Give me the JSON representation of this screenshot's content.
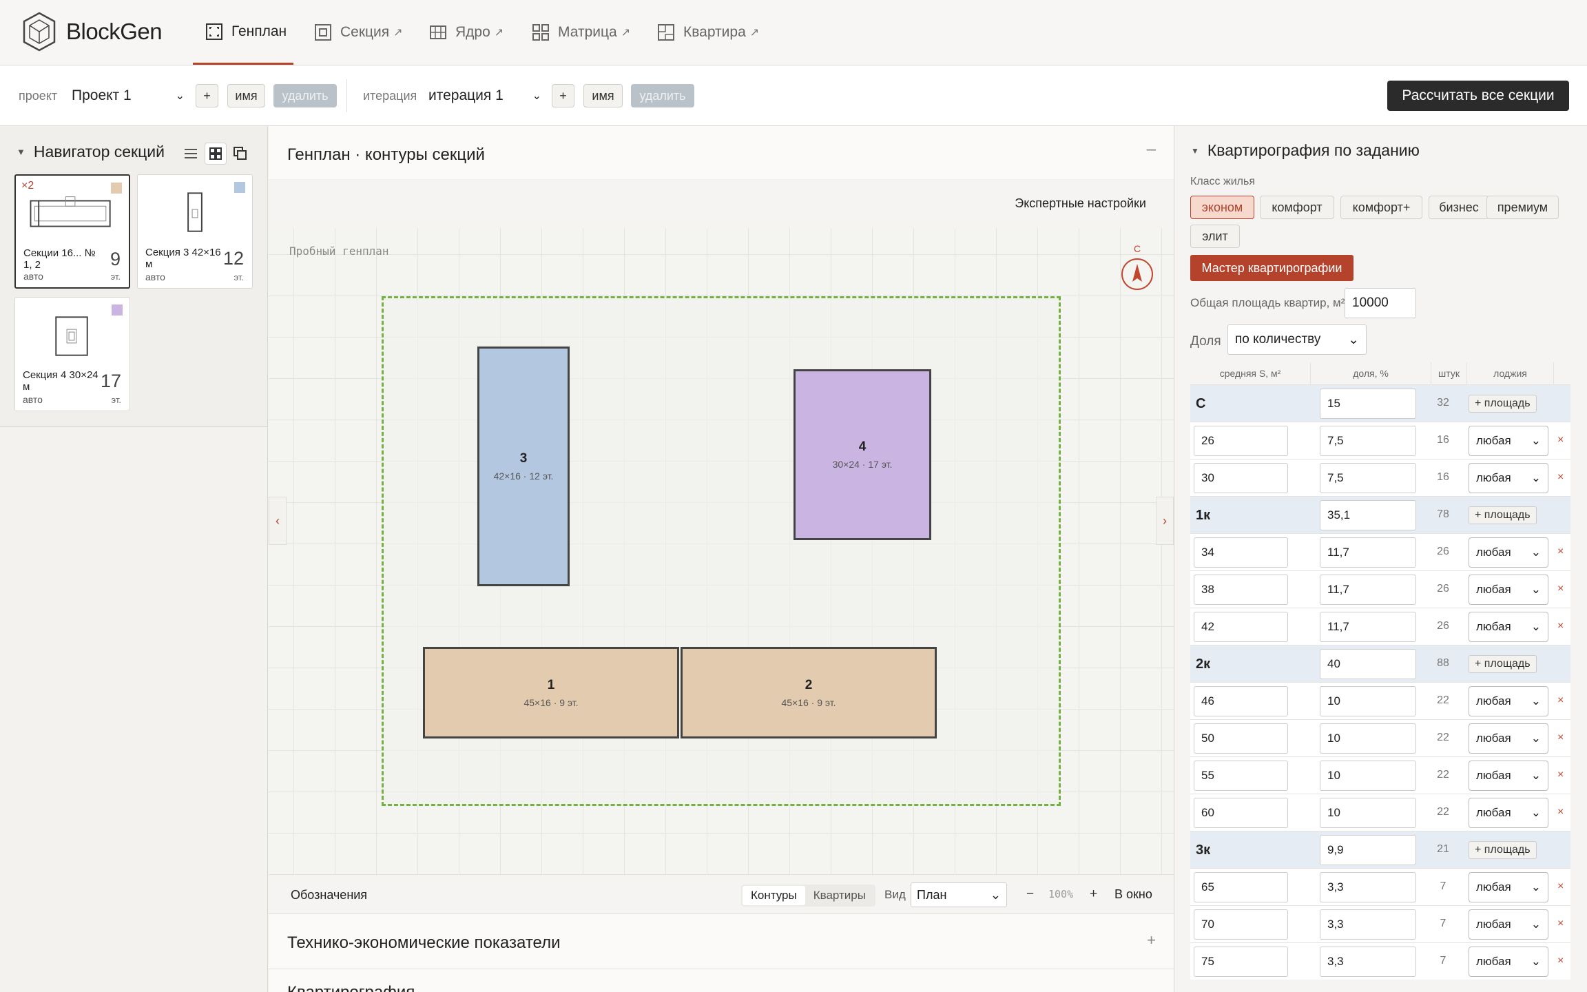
{
  "app": {
    "name": "BlockGen"
  },
  "nav": {
    "tabs": [
      {
        "label": "Генплан",
        "ext": ""
      },
      {
        "label": "Секция",
        "ext": "↗"
      },
      {
        "label": "Ядро",
        "ext": "↗"
      },
      {
        "label": "Матрица",
        "ext": "↗"
      },
      {
        "label": "Квартира",
        "ext": "↗"
      }
    ]
  },
  "project_bar": {
    "project_label": "проект",
    "project_value": "Проект 1",
    "add": "+",
    "name": "имя",
    "delete": "удалить",
    "iteration_label": "итерация",
    "iteration_value": "итерация 1",
    "calc_all": "Рассчитать все секции"
  },
  "navigator": {
    "title": "Навигатор секций",
    "cards": [
      {
        "mult": "×2",
        "name": "Секции 16... № 1, 2",
        "mode": "авто",
        "floors": "9",
        "unit": "эт.",
        "color": "#e3cbb0"
      },
      {
        "mult": "",
        "name": "Секция 3 42×16 м",
        "mode": "авто",
        "floors": "12",
        "unit": "эт.",
        "color": "#b3c8e0"
      },
      {
        "mult": "",
        "name": "Секция 4 30×24 м",
        "mode": "авто",
        "floors": "17",
        "unit": "эт.",
        "color": "#c9b4e2"
      }
    ]
  },
  "genplan": {
    "title": "Генплан · контуры секций",
    "collapse": "–",
    "expert": "Экспертные настройки",
    "canvas_label": "Пробный генплан",
    "compass": "С",
    "buildings": [
      {
        "num": "3",
        "info": "42×16 · 12 эт.",
        "color": "#b3c8e0"
      },
      {
        "num": "4",
        "info": "30×24 · 17 эт.",
        "color": "#c9b4e2"
      },
      {
        "num": "1",
        "info": "45×16 · 9 эт.",
        "color": "#e3cbb0"
      },
      {
        "num": "2",
        "info": "45×16 · 9 эт.",
        "color": "#e3cbb0"
      }
    ],
    "legend": "Обозначения",
    "seg_contours": "Контуры",
    "seg_apts": "Квартиры",
    "view_label": "Вид",
    "view_value": "План",
    "zoom_minus": "−",
    "zoom": "100%",
    "zoom_plus": "+",
    "fit": "В окно"
  },
  "tep": {
    "title": "Технико-экономические показатели",
    "plus": "+"
  },
  "next_section": {
    "title": "Квартирография"
  },
  "kv": {
    "title": "Квартирография по заданию",
    "class_label": "Класс жилья",
    "classes": [
      "эконом",
      "комфорт",
      "комфорт+",
      "бизнес",
      "премиум",
      "элит"
    ],
    "active_class": "эконом",
    "wizard": "Мастер квартирографии",
    "area_label": "Общая площадь квартир, м²",
    "area_value": "10000",
    "share_label": "Доля",
    "share_value": "по количеству",
    "headers": [
      "средняя S, м²",
      "доля, %",
      "штук",
      "лоджия"
    ],
    "add_area": "+ площадь",
    "loggia_any": "любая",
    "del": "×",
    "groups": [
      {
        "name": "С",
        "share": "15",
        "count": "32",
        "rows": [
          {
            "area": "26",
            "share": "7,5",
            "count": "16"
          },
          {
            "area": "30",
            "share": "7,5",
            "count": "16"
          }
        ]
      },
      {
        "name": "1к",
        "share": "35,1",
        "count": "78",
        "rows": [
          {
            "area": "34",
            "share": "11,7",
            "count": "26"
          },
          {
            "area": "38",
            "share": "11,7",
            "count": "26"
          },
          {
            "area": "42",
            "share": "11,7",
            "count": "26"
          }
        ]
      },
      {
        "name": "2к",
        "share": "40",
        "count": "88",
        "rows": [
          {
            "area": "46",
            "share": "10",
            "count": "22"
          },
          {
            "area": "50",
            "share": "10",
            "count": "22"
          },
          {
            "area": "55",
            "share": "10",
            "count": "22"
          },
          {
            "area": "60",
            "share": "10",
            "count": "22"
          }
        ]
      },
      {
        "name": "3к",
        "share": "9,9",
        "count": "21",
        "rows": [
          {
            "area": "65",
            "share": "3,3",
            "count": "7"
          },
          {
            "area": "70",
            "share": "3,3",
            "count": "7"
          },
          {
            "area": "75",
            "share": "3,3",
            "count": "7"
          }
        ]
      }
    ]
  },
  "colors": {
    "accent": "#b5432c",
    "site_border": "#75b043",
    "dark_button": "#2b2b2b"
  }
}
